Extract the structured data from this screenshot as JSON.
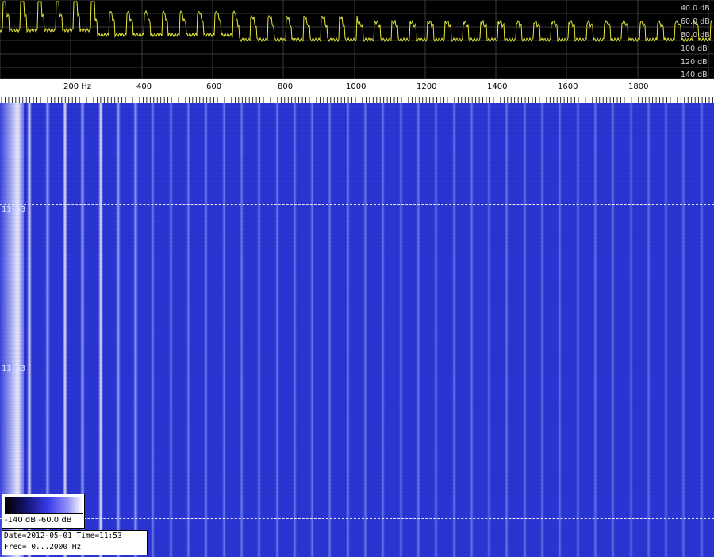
{
  "spectrum": {
    "db_labels": [
      "40.0 dB",
      "60.0 dB",
      "80.0 dB",
      "100 dB",
      "120 dB",
      "140 dB"
    ],
    "colors": {
      "background": "#000000",
      "grid": "#3a3a3a",
      "trace": "#e8e83a"
    }
  },
  "freq_axis": {
    "labels": [
      "200 Hz",
      "400",
      "600",
      "800",
      "1000",
      "1200",
      "1400",
      "1600",
      "1800"
    ]
  },
  "waterfall": {
    "time_labels": [
      "11:53",
      "11:53"
    ],
    "colors": {
      "base": "#2a36d6",
      "stripe_bright": "#a0a8ff",
      "stripe_white": "#f2f2ff"
    }
  },
  "colorbar": {
    "min_label": "-140 dB",
    "max_label": "-60.0 dB"
  },
  "info": {
    "line1": "Date=2012-05-01 Time=11:53",
    "line2": "Freq= 0...2000 Hz"
  }
}
